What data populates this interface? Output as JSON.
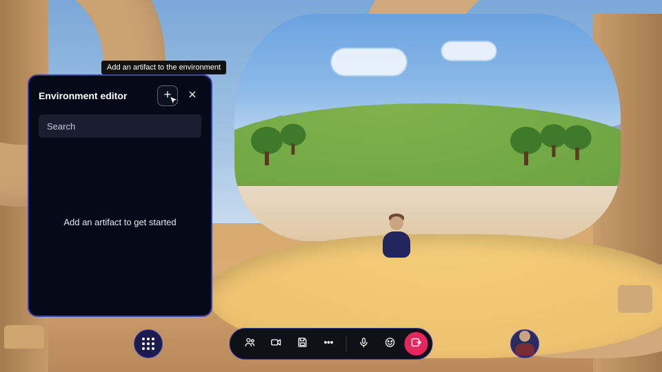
{
  "panel": {
    "title": "Environment editor",
    "search_placeholder": "Search",
    "empty_state": "Add an artifact to get started",
    "add_tooltip": "Add an artifact to the environment"
  },
  "icons": {
    "add": "plus-icon",
    "close": "close-icon",
    "apps": "apps-grid-icon",
    "people": "people-icon",
    "video": "video-camera-icon",
    "save": "save-icon",
    "more": "more-ellipsis-icon",
    "mic": "microphone-icon",
    "emoji": "emoji-reaction-icon",
    "leave": "leave-screen-icon",
    "avatar": "user-avatar-icon"
  },
  "colors": {
    "panel_bg": "#050a18",
    "panel_border": "#3f3fb4",
    "toolbar_bg": "#101018",
    "accent_red": "#e6265d"
  }
}
